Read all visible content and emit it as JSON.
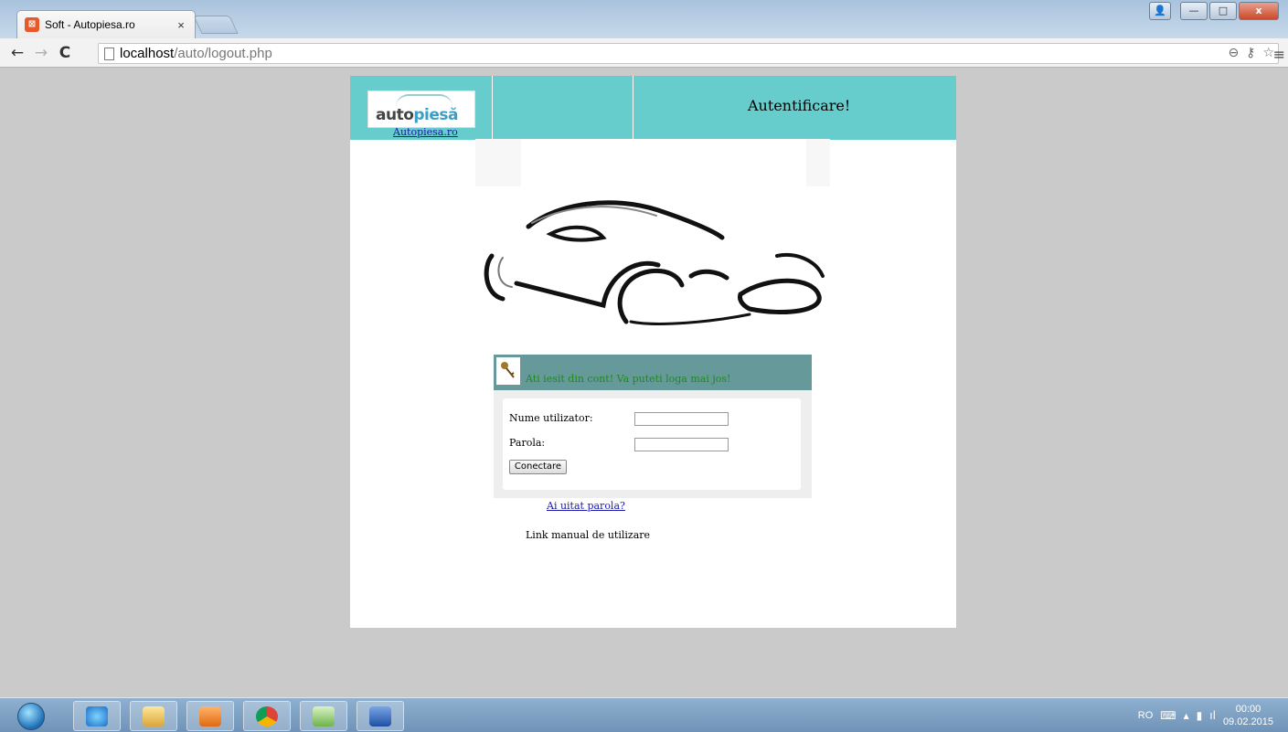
{
  "browser": {
    "tab_title": "Soft - Autopiesa.ro",
    "tab_close": "×",
    "url_host": "localhost",
    "url_path": "/auto/logout.php",
    "back": "←",
    "forward": "→",
    "reload": "C",
    "window_buttons": {
      "minimize": "—",
      "maximize": "□",
      "close": "x"
    }
  },
  "header": {
    "logo_text_main": "auto",
    "logo_text_accent": "piesă",
    "logo_link": "Autopiesa.ro",
    "title": "Autentificare!"
  },
  "message": "Ati iesit din cont! Va puteti loga mai jos!",
  "form": {
    "username_label": "Nume utilizator:",
    "password_label": "Parola:",
    "username_value": "",
    "password_value": "",
    "submit_label": "Conectare"
  },
  "links": {
    "forgot_password": "Ai uitat parola?",
    "manual": "Link manual de utilizare"
  },
  "taskbar": {
    "language": "RO",
    "time": "00:00",
    "date": "09.02.2015"
  },
  "colors": {
    "header_bg": "#66cccc",
    "message_bar": "#669999",
    "message_text": "#1f8a1f",
    "link": "#1a1aa6"
  }
}
